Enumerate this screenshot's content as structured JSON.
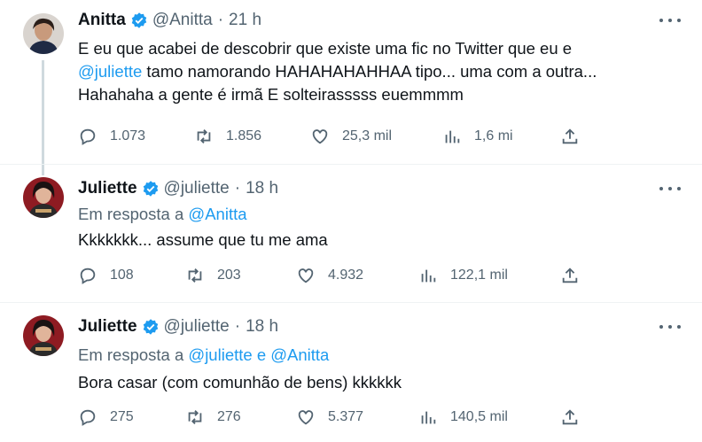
{
  "tweets": [
    {
      "name": "Anitta",
      "handle": "@Anitta",
      "time": "21 h",
      "text_parts": [
        "E eu que acabei de descobrir que existe uma fic no Twitter que eu e",
        "@juliette",
        " tamo namorando HAHAHAHAHHAA tipo... uma com a outra...",
        "Hahahaha a gente é irmã E solteirasssss euemmmm"
      ],
      "replies": "1.073",
      "retweets": "1.856",
      "likes": "25,3 mil",
      "views": "1,6 mi"
    },
    {
      "name": "Juliette",
      "handle": "@juliette",
      "time": "18 h",
      "reply_prefix": "Em resposta a ",
      "reply_mentions": "@Anitta",
      "text": "Kkkkkkk... assume que tu me ama",
      "replies": "108",
      "retweets": "203",
      "likes": "4.932",
      "views": "122,1 mil"
    },
    {
      "name": "Juliette",
      "handle": "@juliette",
      "time": "18 h",
      "reply_prefix": "Em resposta a ",
      "reply_mentions": "@juliette e @Anitta",
      "text": "Bora casar (com comunhão de bens) kkkkkk",
      "replies": "275",
      "retweets": "276",
      "likes": "5.377",
      "views": "140,5 mil"
    }
  ],
  "icons": {
    "verified": "verified-badge-icon",
    "reply": "reply-icon",
    "retweet": "retweet-icon",
    "like": "heart-icon",
    "views": "views-icon",
    "share": "share-icon",
    "more": "more-icon"
  },
  "colors": {
    "accent": "#1d9bf0",
    "muted": "#536471",
    "text": "#0f1419",
    "thread": "#cfd9de"
  }
}
